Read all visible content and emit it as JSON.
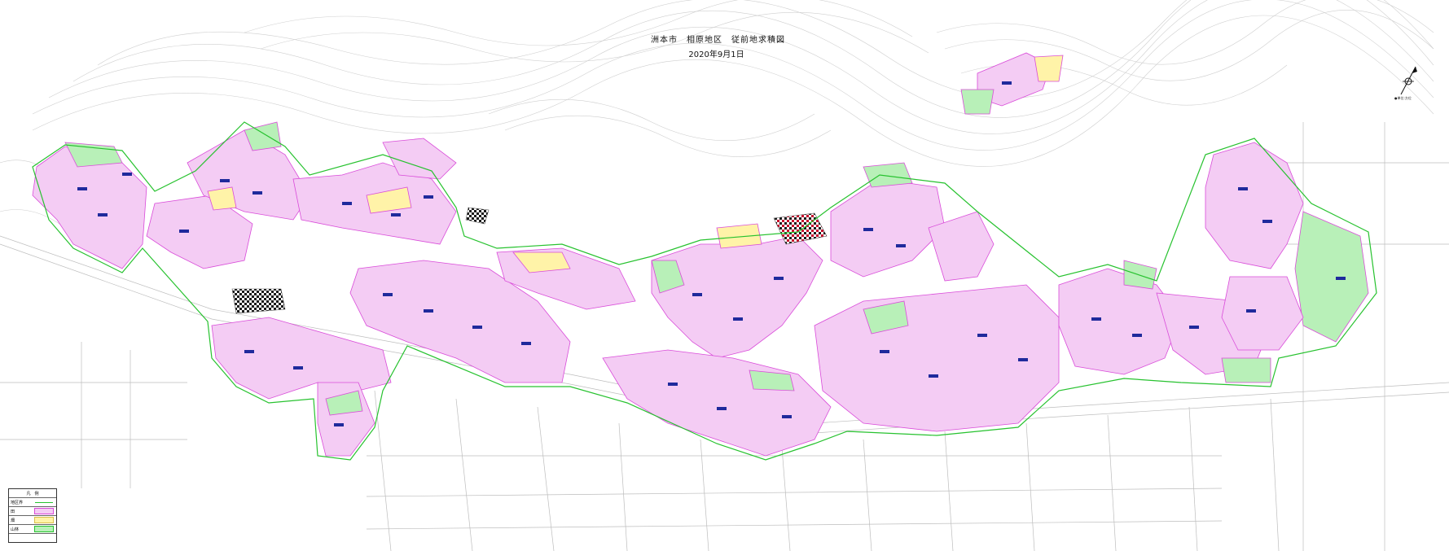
{
  "title": "洲本市　相原地区　従前地求積図",
  "date": "2020年9月1日",
  "north_label": "●単位:方位",
  "legend": {
    "header": "凡　例",
    "items": [
      {
        "label": "地区界",
        "swatch": "green-line"
      },
      {
        "label": "田",
        "swatch": "pink"
      },
      {
        "label": "畑",
        "swatch": "yellow"
      },
      {
        "label": "山林",
        "swatch": "green"
      },
      {
        "label": "",
        "swatch": "none"
      }
    ]
  },
  "colors": {
    "paddy": "#f4ccf4",
    "field": "#fff3a8",
    "forest": "#b8f0b8",
    "boundary": "#27c22f",
    "contour": "#c9c9c9",
    "parcel_line": "#d94bd9"
  }
}
